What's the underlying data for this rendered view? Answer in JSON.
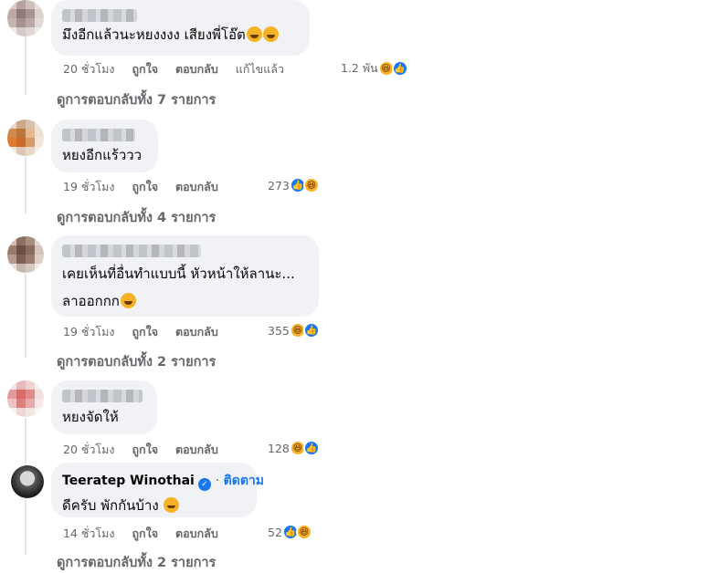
{
  "comments": [
    {
      "text": "มึงอีกแล้วนะหยงงงง เสียงพี่โอ๊ต",
      "time": "20 ชั่วโมง",
      "like": "ถูกใจ",
      "reply": "ตอบกลับ",
      "edited": "แก้ไขแล้ว",
      "reaction_count": "1.2 พัน",
      "reactions": [
        "haha-icon",
        "like-icon"
      ],
      "view_replies": "ดูการตอบกลับทั้ง 7 รายการ",
      "avatar_colors": [
        "#d9c9c6",
        "#b7a3a1",
        "#cfc0bd",
        "#e8dfdd",
        "#bda7a4",
        "#8f7a77",
        "#a99390",
        "#ddd1cf",
        "#c4b3b0",
        "#a5918e",
        "#b9a8a5",
        "#e3d9d7",
        "#efe8e7",
        "#d6cac8",
        "#e0d6d4",
        "#f2eded"
      ]
    },
    {
      "text": "หยงอีกแร้ววว",
      "time": "19 ชั่วโมง",
      "like": "ถูกใจ",
      "reply": "ตอบกลับ",
      "reaction_count": "273",
      "reactions": [
        "like-icon",
        "haha-icon"
      ],
      "view_replies": "ดูการตอบกลับทั้ง 4 รายการ",
      "avatar_colors": [
        "#e5d6c8",
        "#c9a98a",
        "#d8c1a8",
        "#efe5da",
        "#d08b4c",
        "#b9773c",
        "#e6b78d",
        "#f0e2d3",
        "#e07a2e",
        "#c86b2b",
        "#d99a66",
        "#f3e6da",
        "#f1e8df",
        "#dcc8b5",
        "#e9d8c6",
        "#f7f0e9"
      ]
    },
    {
      "text": "เคยเห็นที่อื่นทำแบบนี้ หัวหน้าให้ลานะ...",
      "text2": "ลาออกกก",
      "time": "19 ชั่วโมง",
      "like": "ถูกใจ",
      "reply": "ตอบกลับ",
      "reaction_count": "355",
      "reactions": [
        "haha-icon",
        "like-icon"
      ],
      "view_replies": "ดูการตอบกลับทั้ง 2 รายการ",
      "avatar_colors": [
        "#cdbdb4",
        "#8d6f62",
        "#a98c7e",
        "#e1d6cf",
        "#9b7b6c",
        "#6d5043",
        "#8a6b5c",
        "#d4c4bb",
        "#b49b8e",
        "#7f6153",
        "#9a7d6f",
        "#dccfc8",
        "#e8e0db",
        "#c7b5ab",
        "#d6c8c0",
        "#f0ebe7"
      ]
    },
    {
      "text": "หยงจัดให้",
      "time": "20 ชั่วโมง",
      "like": "ถูกใจ",
      "reply": "ตอบกลับ",
      "reaction_count": "128",
      "reactions": [
        "haha-icon",
        "like-icon"
      ],
      "avatar_colors": [
        "#f3e3e3",
        "#e9b9b9",
        "#f0d0d0",
        "#f7eeee",
        "#e49a9a",
        "#d96b6b",
        "#e38a8a",
        "#f3dede",
        "#eec3c3",
        "#dd7f7f",
        "#e9aaaa",
        "#f6e6e6",
        "#f8f1f1",
        "#f0d5d5",
        "#f4e3e3",
        "#fbf6f6"
      ]
    }
  ],
  "reply": {
    "author": "Teeratep Winothai",
    "follow": "ติดตาม",
    "text": "ดีครับ พักกันบ้าง",
    "time": "14 ชั่วโมง",
    "like": "ถูกใจ",
    "reply": "ตอบกลับ",
    "reaction_count": "52",
    "reactions": [
      "like-icon",
      "haha-icon"
    ],
    "view_replies": "ดูการตอบกลับทั้ง 2 รายการ",
    "verified_icon": "verified-badge-icon"
  }
}
